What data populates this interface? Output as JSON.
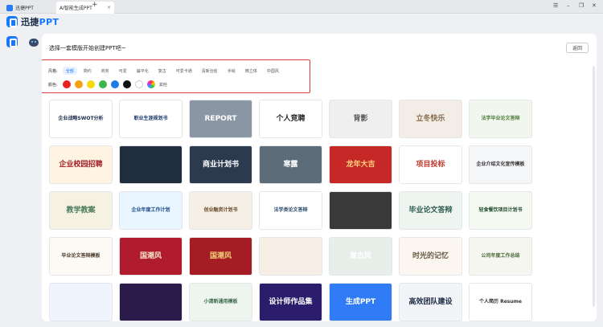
{
  "tabs": [
    {
      "label": "迅捷PPT",
      "active": false
    },
    {
      "label": "AI智能生成PPT",
      "active": true
    }
  ],
  "app": {
    "logo_prefix": "迅捷",
    "logo_suffix": "PPT"
  },
  "panel": {
    "title": "选择一套模版开始创建PPT吧~",
    "back_label": "返回"
  },
  "filters": {
    "style_label": "风格:",
    "styles": [
      "全部",
      "简约",
      "商务",
      "可爱",
      "扁平化",
      "复古",
      "可爱卡通",
      "清新治愈",
      "手绘",
      "微立体",
      "中国风"
    ],
    "color_label": "颜色:",
    "colors": [
      "#e8231f",
      "#f2a10f",
      "#f5d90a",
      "#3bb64a",
      "#1d7ce6",
      "#111111",
      "#ffffff"
    ],
    "rainbow_label": "其他"
  },
  "templates": [
    [
      "企业战略SWOT分析",
      "职业生涯规划书",
      "REPORT",
      "个人竞聘",
      "背影",
      "立冬快乐",
      "法学毕业论文答辩"
    ],
    [
      "企业校园招聘",
      "",
      "商业计划书",
      "寒露",
      "龙年大吉",
      "项目投标",
      "企业介绍文化宣传模板"
    ],
    [
      "教学教案",
      "企业年度工作计划",
      "创业融资计划书",
      "法学类论文答辩",
      "",
      "毕业论文答辩",
      "轻食餐饮项目计划书"
    ],
    [
      "毕业论文答辩模板",
      "国潮风",
      "国潮风",
      "",
      "复古风",
      "时光的记忆",
      "公司年度工作总结"
    ],
    [
      "",
      "",
      "小清新通用模板",
      "设计师作品集",
      "生成PPT",
      "高效团队建设",
      "个人简历 Resume"
    ]
  ]
}
